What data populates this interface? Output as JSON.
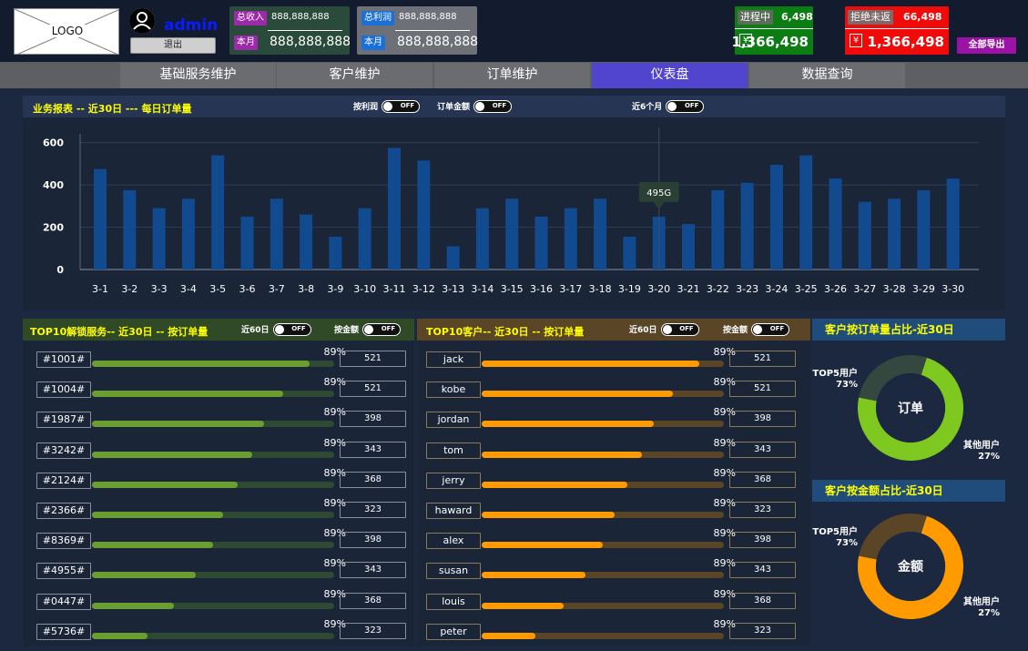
{
  "header": {
    "logo_text": "LOGO",
    "username": "admin",
    "logout_label": "退出",
    "revenue": {
      "tag": "总收入",
      "total": "888,888,888",
      "month_tag": "本月",
      "month": "888,888,888"
    },
    "profit": {
      "tag": "总利润",
      "total": "888,888,888",
      "month_tag": "本月",
      "month": "888,888,888"
    },
    "in_progress": {
      "label": "进程中",
      "count": "6,498",
      "currency": "¥",
      "amount": "1,366,498"
    },
    "rejected": {
      "label": "拒绝未返",
      "count": "66,498",
      "currency": "¥",
      "amount": "1,366,498"
    },
    "export_label": "全部导出"
  },
  "nav": {
    "tabs": [
      "基础服务维护",
      "客户维护",
      "订单维护",
      "仪表盘",
      "数据查询"
    ],
    "active": 3
  },
  "report": {
    "title": "业务报表 -- 近30日 --- 每日订单量",
    "toggles": [
      {
        "label": "按利润",
        "state": "OFF"
      },
      {
        "label": "订单金额",
        "state": "OFF"
      },
      {
        "label": "近6个月",
        "state": "OFF"
      }
    ],
    "tooltip": "495G"
  },
  "chart_data": {
    "type": "bar",
    "title": "业务报表 -- 近30日 --- 每日订单量",
    "categories": [
      "3-1",
      "3-2",
      "3-3",
      "3-4",
      "3-5",
      "3-6",
      "3-7",
      "3-8",
      "3-9",
      "3-10",
      "3-11",
      "3-12",
      "3-13",
      "3-14",
      "3-15",
      "3-16",
      "3-17",
      "3-18",
      "3-19",
      "3-20",
      "3-21",
      "3-22",
      "3-23",
      "3-24",
      "3-25",
      "3-26",
      "3-27",
      "3-28",
      "3-29",
      "3-30"
    ],
    "values": [
      475,
      375,
      290,
      335,
      540,
      250,
      335,
      260,
      155,
      290,
      575,
      515,
      110,
      290,
      335,
      250,
      290,
      335,
      155,
      250,
      215,
      375,
      410,
      495,
      540,
      430,
      320,
      335,
      375,
      430
    ],
    "yticks": [
      0,
      200,
      400,
      600
    ],
    "ylim": [
      0,
      620
    ],
    "grid": true,
    "color": "#124a8f",
    "highlight_index": 19
  },
  "top_services": {
    "title": "TOP10解锁服务-- 近30日 -- 按订单量",
    "toggles": [
      {
        "label": "近60日",
        "state": "OFF"
      },
      {
        "label": "按金额",
        "state": "OFF"
      }
    ],
    "track_color": "#2f4a33",
    "fill_color": "#6a9e2f",
    "rows": [
      {
        "label": "#1001#",
        "pct": "89%",
        "fill": 0.9,
        "value": "521"
      },
      {
        "label": "#1004#",
        "pct": "89%",
        "fill": 0.79,
        "value": "521"
      },
      {
        "label": "#1987#",
        "pct": "89%",
        "fill": 0.71,
        "value": "398"
      },
      {
        "label": "#3242#",
        "pct": "89%",
        "fill": 0.66,
        "value": "343"
      },
      {
        "label": "#2124#",
        "pct": "89%",
        "fill": 0.6,
        "value": "368"
      },
      {
        "label": "#2366#",
        "pct": "89%",
        "fill": 0.54,
        "value": "323"
      },
      {
        "label": "#8369#",
        "pct": "89%",
        "fill": 0.5,
        "value": "398"
      },
      {
        "label": "#4955#",
        "pct": "89%",
        "fill": 0.43,
        "value": "343"
      },
      {
        "label": "#0447#",
        "pct": "89%",
        "fill": 0.34,
        "value": "368"
      },
      {
        "label": "#5736#",
        "pct": "89%",
        "fill": 0.23,
        "value": "323"
      }
    ]
  },
  "top_customers": {
    "title": "TOP10客户-- 近30日 -- 按订单量",
    "toggles": [
      {
        "label": "近60日",
        "state": "OFF"
      },
      {
        "label": "按金额",
        "state": "OFF"
      }
    ],
    "track_color": "#5a4526",
    "fill_color": "#ff9a00",
    "rows": [
      {
        "label": "jack",
        "pct": "89%",
        "fill": 0.9,
        "value": "521"
      },
      {
        "label": "kobe",
        "pct": "89%",
        "fill": 0.79,
        "value": "521"
      },
      {
        "label": "jordan",
        "pct": "89%",
        "fill": 0.71,
        "value": "398"
      },
      {
        "label": "tom",
        "pct": "89%",
        "fill": 0.66,
        "value": "343"
      },
      {
        "label": "jerry",
        "pct": "89%",
        "fill": 0.6,
        "value": "368"
      },
      {
        "label": "haward",
        "pct": "89%",
        "fill": 0.55,
        "value": "323"
      },
      {
        "label": "alex",
        "pct": "89%",
        "fill": 0.5,
        "value": "398"
      },
      {
        "label": "susan",
        "pct": "89%",
        "fill": 0.43,
        "value": "343"
      },
      {
        "label": "louis",
        "pct": "89%",
        "fill": 0.34,
        "value": "368"
      },
      {
        "label": "peter",
        "pct": "89%",
        "fill": 0.22,
        "value": "323"
      }
    ]
  },
  "donut_orders": {
    "title": "客户按订单量占比-近30日",
    "center": "订单",
    "top_label": "TOP5用户",
    "top_pct": "73%",
    "top_value": 73,
    "top_color": "#7ec820",
    "other_label": "其他用户",
    "other_pct": "27%",
    "other_color": "#35483f"
  },
  "donut_amount": {
    "title": "客户按金额占比-近30日",
    "center": "金额",
    "top_label": "TOP5用户",
    "top_pct": "73%",
    "top_value": 73,
    "top_color": "#ff9a00",
    "other_label": "其他用户",
    "other_pct": "27%",
    "other_color": "#5a4526"
  }
}
